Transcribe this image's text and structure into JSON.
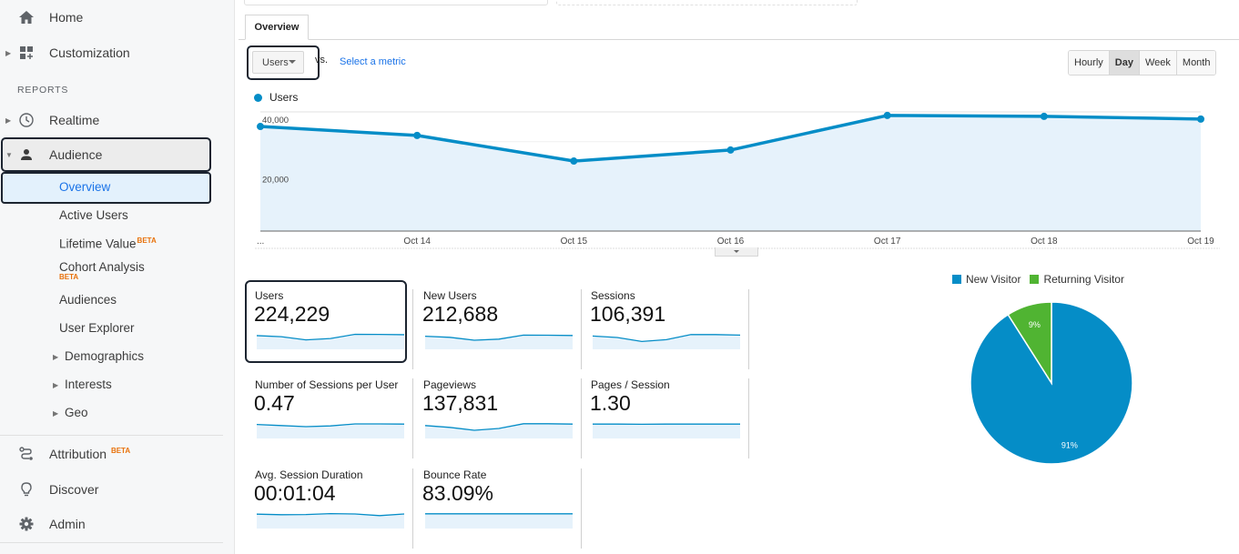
{
  "sidebar": {
    "home": "Home",
    "customization": "Customization",
    "reports_label": "REPORTS",
    "realtime": "Realtime",
    "audience": "Audience",
    "audience_items": [
      {
        "label": "Overview"
      },
      {
        "label": "Active Users"
      },
      {
        "label": "Lifetime Value",
        "badge": "BETA"
      },
      {
        "label": "Cohort Analysis",
        "badge": "BETA"
      },
      {
        "label": "Audiences"
      },
      {
        "label": "User Explorer"
      },
      {
        "label": "Demographics"
      },
      {
        "label": "Interests"
      },
      {
        "label": "Geo"
      }
    ],
    "attribution": "Attribution",
    "attribution_badge": "BETA",
    "discover": "Discover",
    "admin": "Admin"
  },
  "main": {
    "tab": "Overview",
    "metric_select": "Users",
    "vs_label": "vs.",
    "select_metric_link": "Select a metric",
    "periods": [
      {
        "label": "Hourly",
        "active": false
      },
      {
        "label": "Day",
        "active": true
      },
      {
        "label": "Week",
        "active": false
      },
      {
        "label": "Month",
        "active": false
      }
    ],
    "legend_label": "Users"
  },
  "chart_data": [
    {
      "type": "area",
      "title": "",
      "series": [
        {
          "name": "Users",
          "color": "#058dc7",
          "values": [
            35100,
            32100,
            23500,
            27200,
            38800,
            38500,
            37600
          ]
        }
      ],
      "x": [
        "...",
        "Oct 14",
        "Oct 15",
        "Oct 16",
        "Oct 17",
        "Oct 18",
        "Oct 19"
      ],
      "y_ticks": [
        "20,000",
        "40,000"
      ],
      "ylim": [
        0,
        40000
      ],
      "grid": true,
      "legend": "top-left"
    },
    {
      "type": "pie",
      "title": "",
      "categories": [
        "New Visitor",
        "Returning Visitor"
      ],
      "values": [
        91,
        9
      ],
      "labels": [
        "91%",
        "9%"
      ],
      "colors": [
        "#058dc7",
        "#50b432"
      ],
      "legend": "top"
    }
  ],
  "scorecards": [
    {
      "label": "Users",
      "value": "224,229",
      "spark": [
        35100,
        32100,
        23500,
        27200,
        38800,
        38500,
        37600
      ]
    },
    {
      "label": "New Users",
      "value": "212,688",
      "spark": [
        33500,
        30500,
        22500,
        25500,
        36500,
        36300,
        35500
      ]
    },
    {
      "label": "Sessions",
      "value": "106,391",
      "spark": [
        34000,
        30000,
        19000,
        24000,
        38000,
        38000,
        36500
      ]
    },
    {
      "label": "Number of Sessions per User",
      "value": "0.47",
      "spark": [
        36000,
        33000,
        30000,
        32000,
        37500,
        37500,
        37000
      ]
    },
    {
      "label": "Pageviews",
      "value": "137,831",
      "spark": [
        33000,
        28000,
        20000,
        25000,
        38000,
        38000,
        37000
      ]
    },
    {
      "label": "Pages / Session",
      "value": "1.30",
      "spark": [
        37000,
        37000,
        36500,
        37000,
        37000,
        37000,
        37000
      ]
    },
    {
      "label": "Avg. Session Duration",
      "value": "00:01:04",
      "spark": [
        37000,
        35500,
        36000,
        38500,
        37500,
        33000,
        37500
      ]
    },
    {
      "label": "Bounce Rate",
      "value": "83.09%",
      "spark": [
        38000,
        38000,
        38000,
        38000,
        38000,
        38000,
        38000
      ]
    }
  ]
}
